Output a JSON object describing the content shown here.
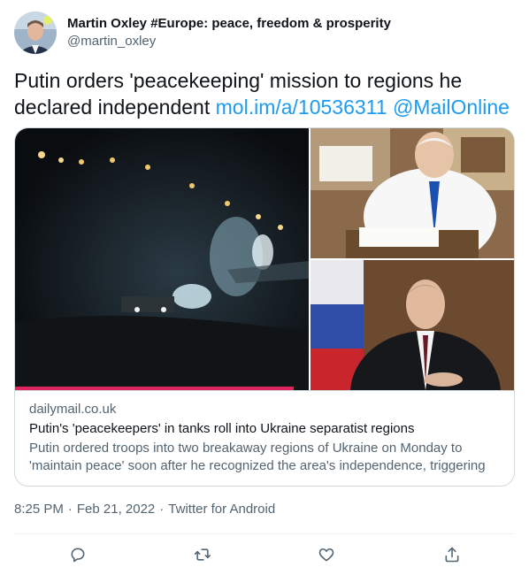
{
  "author": {
    "display_name": "Martin Oxley #Europe: peace, freedom & prosperity",
    "handle": "@martin_oxley"
  },
  "tweet": {
    "text_prefix": "Putin orders 'peacekeeping' mission to regions he declared independent",
    "link": "mol.im/a/10536311",
    "mention": "@MailOnline"
  },
  "card": {
    "domain": "dailymail.co.uk",
    "title": "Putin's 'peacekeepers' in tanks roll into Ukraine separatist regions",
    "description": "Putin ordered troops into two breakaway regions of Ukraine on Monday to 'maintain peace' soon after he recognized the area's independence, triggering ...",
    "video_progress_percent": 95
  },
  "meta": {
    "time": "8:25 PM",
    "separator": "·",
    "date": "Feb 21, 2022",
    "source": "Twitter for Android"
  },
  "icons": {
    "reply": "reply-icon",
    "retweet": "retweet-icon",
    "like": "like-icon",
    "share": "share-icon"
  },
  "colors": {
    "link": "#1d9bf0",
    "secondary_text": "#536471",
    "border": "#cfd9de",
    "progress": "#e0245e"
  }
}
